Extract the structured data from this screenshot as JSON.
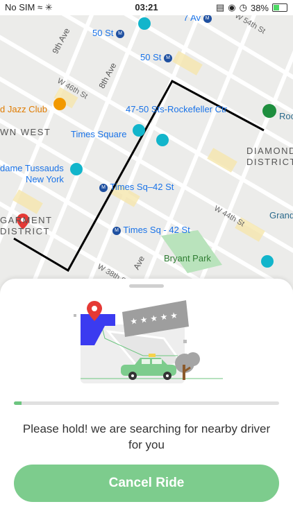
{
  "status_bar": {
    "carrier": "No SIM",
    "time": "03:21",
    "battery_percent": "38%",
    "battery_level": 0.38
  },
  "map": {
    "streets": [
      "9th Ave",
      "8th Ave",
      "W 46th St",
      "W 44th St",
      "W 38th St",
      "7 Av",
      "W 54th St",
      "Ave"
    ],
    "stations": [
      "50 St",
      "50 St",
      "7 Av",
      "47-50 Sts-Rockefeller Ctr",
      "Times Sq–42 St",
      "Times Sq - 42 St"
    ],
    "places": {
      "jazz_club": "d Jazz Club",
      "times_square": "Times Square",
      "madame_tussauds_line1": "dame Tussauds",
      "madame_tussauds_line2": "New York",
      "bryant_park": "Bryant Park",
      "grand": "Grand",
      "roc": "Roc"
    },
    "districts": {
      "west_line1": "WN WEST",
      "diamond_line1": "DIAMOND",
      "diamond_line2": "DISTRICT",
      "garment_line1": "GARMENT",
      "garment_line2": "DISTRICT"
    }
  },
  "sheet": {
    "progress": 0.03,
    "message": "Please hold! we are searching for nearby driver for you",
    "cancel_label": "Cancel Ride"
  },
  "colors": {
    "accent_green": "#7dcc8d",
    "route": "#000000",
    "pin_red": "#e53935",
    "brand_blue": "#3b3bf0"
  }
}
